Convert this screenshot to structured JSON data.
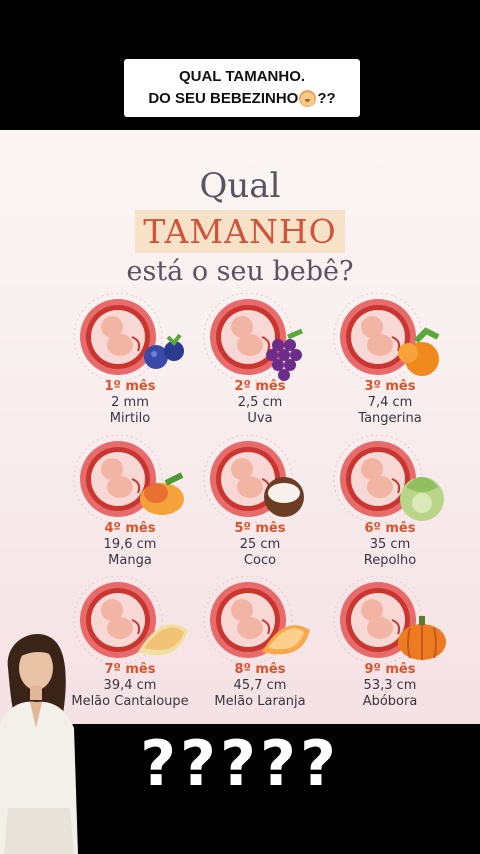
{
  "caption": {
    "line1": "QUAL TAMANHO.",
    "line2_start": "DO SEU BEBEZINHO",
    "line2_end": "??",
    "emoji": "baby-face-icon"
  },
  "poster": {
    "title_line1": "Qual",
    "title_highlight": "TAMANHO",
    "title_line3": "está o seu bebê?",
    "months": [
      {
        "label": "1º mês",
        "size": "2 mm",
        "fruit": "Mirtilo",
        "icon": "blueberry-icon"
      },
      {
        "label": "2º mês",
        "size": "2,5 cm",
        "fruit": "Uva",
        "icon": "grape-icon"
      },
      {
        "label": "3º mês",
        "size": "7,4 cm",
        "fruit": "Tangerina",
        "icon": "tangerine-icon"
      },
      {
        "label": "4º mês",
        "size": "19,6 cm",
        "fruit": "Manga",
        "icon": "mango-icon"
      },
      {
        "label": "5º mês",
        "size": "25 cm",
        "fruit": "Coco",
        "icon": "coconut-icon"
      },
      {
        "label": "6º mês",
        "size": "35 cm",
        "fruit": "Repolho",
        "icon": "cabbage-icon"
      },
      {
        "label": "7º mês",
        "size": "39,4 cm",
        "fruit": "Melão Cantaloupe",
        "icon": "cantaloupe-icon"
      },
      {
        "label": "8º mês",
        "size": "45,7 cm",
        "fruit": "Melão Laranja",
        "icon": "orange-melon-icon"
      },
      {
        "label": "9º mês",
        "size": "53,3 cm",
        "fruit": "Abóbora",
        "icon": "pumpkin-icon"
      }
    ]
  },
  "bottom_overlay": "?????",
  "colors": {
    "accent": "#d8542e",
    "title": "#5c5160",
    "highlight_bg": "#f6e2c6",
    "womb": "#d9534f"
  }
}
